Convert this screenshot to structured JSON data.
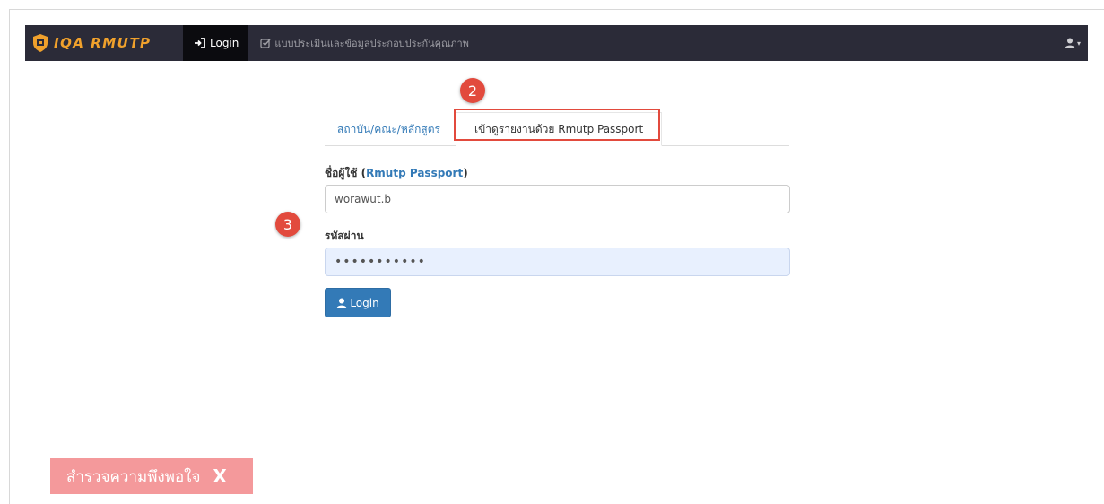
{
  "navbar": {
    "brand": "IQA RMUTP",
    "login_label": "Login",
    "menu_label": "แบบประเมินและข้อมูลประกอบประกันคุณภาพ",
    "user_icon": "user-icon",
    "caret": "▾"
  },
  "annotations": {
    "step2": "2",
    "step3": "3",
    "highlight_color": "#e24a3d"
  },
  "tabs": [
    {
      "label": "สถาบัน/คณะ/หลักสูตร"
    },
    {
      "label": "เข้าดูรายงานด้วย Rmutp Passport"
    }
  ],
  "form": {
    "username_label_prefix": "ชื่อผู้ใช้ (",
    "username_label_link": "Rmutp Passport",
    "username_label_suffix": ")",
    "username_value": "worawut.b",
    "password_label": "รหัสผ่าน",
    "password_value": "•••••••••••",
    "login_button": "Login"
  },
  "survey": {
    "label": "สำรวจความพึงพอใจ",
    "close": "X"
  },
  "colors": {
    "navbar": "#2b2b38",
    "brand": "#f0a12c",
    "primary": "#337ab7",
    "survey": "#f4999b"
  }
}
